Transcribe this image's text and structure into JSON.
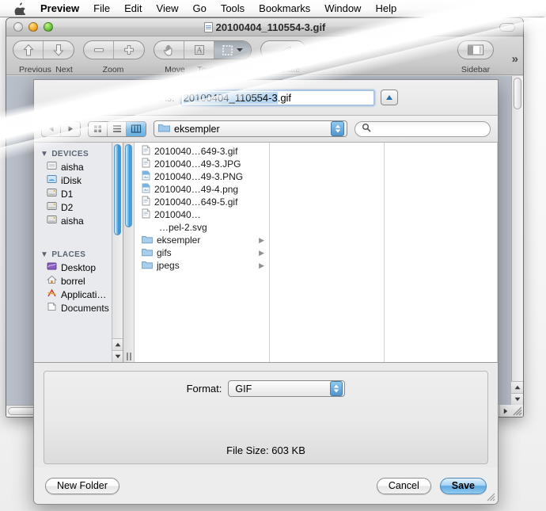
{
  "menubar": {
    "apple_icon": "apple-logo",
    "items": [
      "Preview",
      "File",
      "Edit",
      "View",
      "Go",
      "Tools",
      "Bookmarks",
      "Window",
      "Help"
    ]
  },
  "window": {
    "title": "20100404_110554-3.gif",
    "doc_icon": "document-icon",
    "traffic_lights": [
      "close",
      "minimize",
      "zoom"
    ]
  },
  "toolbar": {
    "groups": [
      {
        "labels": [
          "Previous",
          "Next"
        ],
        "icons": [
          "arrow-up-icon",
          "arrow-down-icon"
        ]
      },
      {
        "labels": [
          "Zoom"
        ],
        "icons": [
          "minus-icon",
          "plus-icon"
        ]
      },
      {
        "labels": [
          "Move",
          "Text"
        ],
        "icons": [
          "hand-icon",
          "text-a-icon"
        ]
      },
      {
        "labels": [
          "Select"
        ],
        "icons": [
          "selection-marquee-icon",
          "chevron-down-icon"
        ]
      },
      {
        "labels": [
          "Annotate"
        ],
        "icons": [
          "pencil-icon"
        ]
      },
      {
        "labels": [
          "Sidebar"
        ],
        "icons": [
          "sidebar-icon"
        ]
      }
    ],
    "overflow_chevron": "»"
  },
  "sheet": {
    "save_as_label": "Save As:",
    "file_name_selected": "20100404_110554-3",
    "file_name_extension": ".gif",
    "disclosure_icon": "triangle-up-icon",
    "nav": {
      "back_icon": "triangle-left-icon",
      "forward_icon": "triangle-right-icon",
      "view_icon_grid": "icon-view-icon",
      "view_list": "list-view-icon",
      "view_column": "column-view-icon",
      "selected_view": "column",
      "path_folder": "eksempler",
      "path_folder_icon": "folder-icon",
      "popup_arrows_icon": "updown-arrows-icon",
      "search_icon": "search-icon",
      "search_placeholder": "",
      "search_value": ""
    },
    "sidebar": {
      "sections": [
        {
          "header": "DEVICES",
          "disclosure": "▼",
          "items": [
            {
              "label": "aisha",
              "icon": "harddisk-icon"
            },
            {
              "label": "iDisk",
              "icon": "idisk-icon"
            },
            {
              "label": "D1",
              "icon": "drive-icon"
            },
            {
              "label": "D2",
              "icon": "drive-icon"
            },
            {
              "label": "aisha",
              "icon": "drive-icon"
            }
          ]
        },
        {
          "header": "PLACES",
          "disclosure": "▼",
          "items": [
            {
              "label": "Desktop",
              "icon": "desktop-icon"
            },
            {
              "label": "borrel",
              "icon": "home-icon"
            },
            {
              "label": "Applicati…",
              "icon": "applications-icon"
            },
            {
              "label": "Documents",
              "icon": "documents-icon"
            }
          ]
        }
      ]
    },
    "file_list": [
      {
        "label": "2010040…649-3.gif",
        "icon": "gif-file-icon",
        "type": "file"
      },
      {
        "label": "2010040…49-3.JPG",
        "icon": "jpg-file-icon",
        "type": "file"
      },
      {
        "label": "2010040…49-3.PNG",
        "icon": "png-file-icon",
        "type": "file"
      },
      {
        "label": "2010040…49-4.png",
        "icon": "png-file-icon",
        "type": "file"
      },
      {
        "label": "2010040…649-5.gif",
        "icon": "gif-file-icon",
        "type": "file"
      },
      {
        "label": "2010040…",
        "icon": "gif-file-icon",
        "type": "file"
      },
      {
        "label": "…pel-2.svg",
        "icon": "svg-file-icon",
        "type": "file"
      },
      {
        "label": "eksempler",
        "icon": "folder-icon",
        "type": "folder",
        "arrow": "▶"
      },
      {
        "label": "gifs",
        "icon": "folder-icon",
        "type": "folder",
        "arrow": "▶"
      },
      {
        "label": "jpegs",
        "icon": "folder-icon",
        "type": "folder",
        "arrow": "▶"
      }
    ],
    "options": {
      "format_label": "Format:",
      "format_value": "GIF",
      "format_arrows_icon": "updown-arrows-icon",
      "file_size_label": "File Size:",
      "file_size_value": "603 KB"
    },
    "buttons": {
      "new_folder": "New Folder",
      "cancel": "Cancel",
      "save": "Save"
    }
  },
  "colors": {
    "selection_blue": "#b5d5f0",
    "accent_blue": "#4f96cf",
    "default_button": "#5ea9e2",
    "sidebar_bg": "#e8eaee"
  }
}
